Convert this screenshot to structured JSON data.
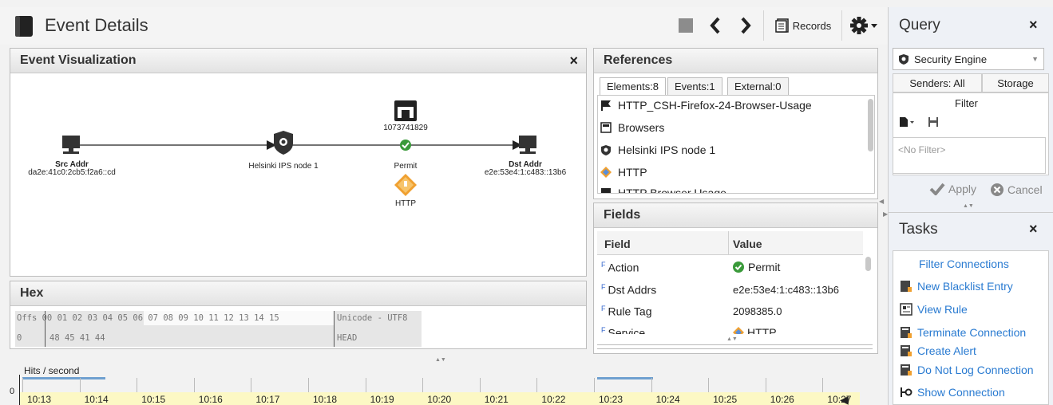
{
  "header": {
    "title": "Event Details",
    "records_label": "Records"
  },
  "visualization": {
    "title": "Event Visualization",
    "close": "×",
    "src_title": "Src Addr",
    "src_addr": "da2e:41c0:2cb5:f2a6::cd",
    "node": "Helsinki IPS node 1",
    "rule_id": "1073741829",
    "action": "Permit",
    "service": "HTTP",
    "dst_title": "Dst Addr",
    "dst_addr": "e2e:53e4:1:c483::13b6"
  },
  "hex": {
    "title": "Hex",
    "header_row": "Offs 00 01 02 03 04 05 06 07  08 09 10 11 12 13 14 15",
    "header_unicode": "Unicode - UTF8",
    "data_offset": "0",
    "data_bytes": "48 45 41 44",
    "data_unicode": "HEAD"
  },
  "references": {
    "title": "References",
    "tabs": [
      "Elements:8",
      "Events:1",
      "External:0"
    ],
    "items": [
      "HTTP_CSH-Firefox-24-Browser-Usage",
      "Browsers",
      "Helsinki IPS node 1",
      "HTTP",
      "HTTP Browser Usage"
    ]
  },
  "fields": {
    "title": "Fields",
    "col_field": "Field",
    "col_value": "Value",
    "rows": [
      {
        "field": "Action",
        "value": "Permit"
      },
      {
        "field": "Dst Addrs",
        "value": "e2e:53e4:1:c483::13b6"
      },
      {
        "field": "Rule Tag",
        "value": "2098385.0"
      },
      {
        "field": "Service",
        "value": "HTTP"
      }
    ]
  },
  "query": {
    "title": "Query",
    "close": "×",
    "engine": "Security Engine",
    "senders": "Senders: All",
    "storage": "Storage",
    "filter_label": "Filter",
    "filter_placeholder": "<No Filter>",
    "apply": "Apply",
    "cancel": "Cancel"
  },
  "tasks": {
    "title": "Tasks",
    "close": "×",
    "filter_connections": "Filter Connections",
    "items": [
      "New Blacklist Entry",
      "View Rule",
      "Terminate Connection",
      "Create Alert",
      "Do Not Log Connection",
      "Show Connection"
    ]
  },
  "timeline": {
    "label": "Hits / second",
    "zero": "0",
    "ticks": [
      "10:13",
      "10:14",
      "10:15",
      "10:16",
      "10:17",
      "10:18",
      "10:19",
      "10:20",
      "10:21",
      "10:22",
      "10:23",
      "10:24",
      "10:25",
      "10:26",
      "10:27"
    ]
  },
  "colors": {
    "accent_blue": "#2a7bd1",
    "permit_green": "#3a9a3a",
    "http_orange": "#f0a030",
    "timeline_yellow": "#fcf8c4"
  }
}
